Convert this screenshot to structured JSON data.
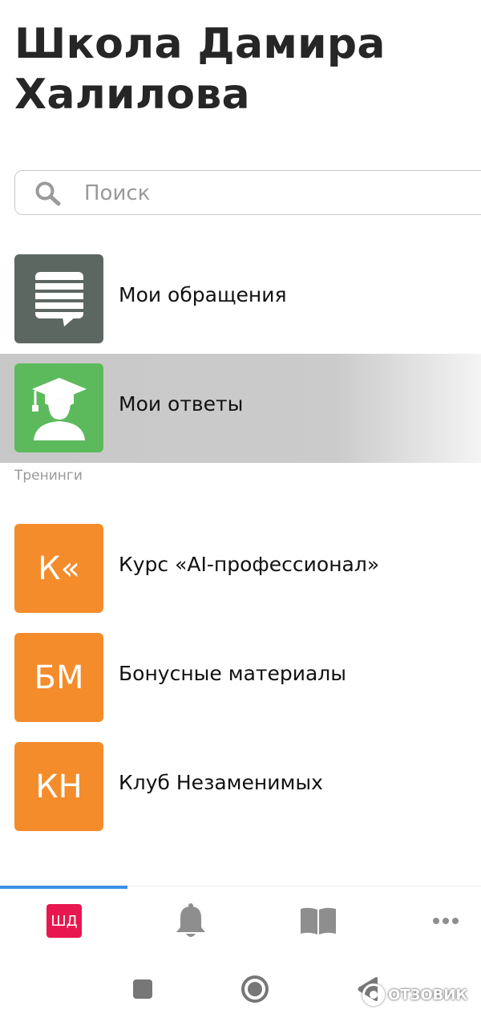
{
  "header": {
    "title": "Школа Дамира Халилова"
  },
  "search": {
    "placeholder": "Поиск"
  },
  "items": [
    {
      "label": "Мои обращения",
      "color": "#5d6762",
      "icon": "message-lines-icon"
    },
    {
      "label": "Мои ответы",
      "color": "#5cba5c",
      "icon": "graduate-icon",
      "selected": true
    }
  ],
  "section_title": "Тренинги",
  "trainings": [
    {
      "abbr": "К«",
      "label": "Курс «AI-профессионал»",
      "color": "#f48c2b"
    },
    {
      "abbr": "БМ",
      "label": "Бонусные материалы",
      "color": "#f48c2b"
    },
    {
      "abbr": "КН",
      "label": "Клуб Незаменимых",
      "color": "#f48c2b"
    }
  ],
  "tabbar": {
    "logo_text": "ШД",
    "logo_color": "#e8174e",
    "accent": "#3d8fe6",
    "icons": [
      "school-logo-icon",
      "bell-icon",
      "book-icon",
      "more-dots-icon"
    ]
  },
  "watermark": {
    "text": "ОТЗОВИК"
  }
}
